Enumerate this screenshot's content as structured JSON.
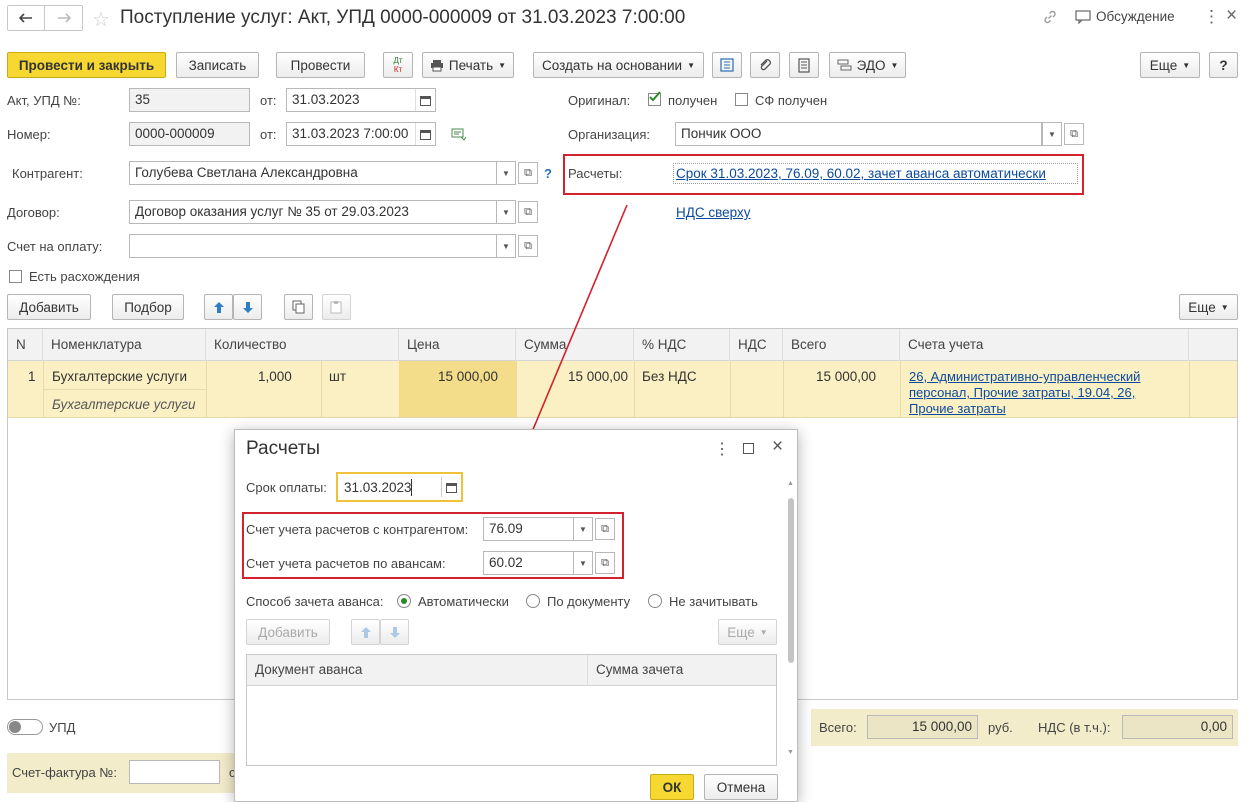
{
  "window": {
    "title": "Поступление услуг: Акт, УПД 0000-000009 от 31.03.2023 7:00:00",
    "discussion": "Обсуждение"
  },
  "toolbar": {
    "post_close": "Провести и закрыть",
    "save": "Записать",
    "post": "Провести",
    "dtkt_top": "Дт",
    "dtkt_bottom": "Кт",
    "print": "Печать",
    "create_based": "Создать на основании",
    "edo": "ЭДО",
    "more": "Еще",
    "help": "?"
  },
  "form": {
    "act_label": "Акт, УПД №:",
    "act_value": "35",
    "from_label": "от:",
    "act_date": "31.03.2023",
    "number_label": "Номер:",
    "number_value": "0000-000009",
    "number_date": "31.03.2023  7:00:00",
    "original_label": "Оригинал:",
    "received_label": "получен",
    "sf_received_label": "СФ получен",
    "org_label": "Организация:",
    "org_value": "Пончик ООО",
    "counterparty_label": "Контрагент:",
    "counterparty_value": "Голубева Светлана Александровна",
    "question": "?",
    "settlements_label": "Расчеты:",
    "settlements_link": "Срок 31.03.2023, 76.09, 60.02, зачет аванса автоматически",
    "vat_link": "НДС сверху",
    "contract_label": "Договор:",
    "contract_value": "Договор оказания услуг № 35 от 29.03.2023",
    "invoice_label": "Счет на оплату:",
    "invoice_value": "",
    "discrepancy_label": "Есть расхождения"
  },
  "table_toolbar": {
    "add": "Добавить",
    "select": "Подбор",
    "more": "Еще"
  },
  "table": {
    "headers": [
      "N",
      "Номенклатура",
      "Количество",
      "Цена",
      "Сумма",
      "% НДС",
      "НДС",
      "Всего",
      "Счета учета"
    ],
    "row": {
      "n": "1",
      "item": "Бухгалтерские услуги",
      "item_sub": "Бухгалтерские услуги",
      "qty": "1,000",
      "unit": "шт",
      "price": "15 000,00",
      "sum": "15 000,00",
      "vat_rate": "Без НДС",
      "vat": "",
      "total": "15 000,00",
      "accounts_1": "26, Административно-управленческий",
      "accounts_2": "персонал, Прочие затраты, 19.04, 26,",
      "accounts_3": "Прочие затраты"
    }
  },
  "footer": {
    "upd_label": "УПД",
    "total_label": "Всего:",
    "total_value": "15 000,00",
    "currency": "руб.",
    "vat_label": "НДС (в т.ч.):",
    "vat_value": "0,00",
    "invoice_label": "Счет-фактура №:",
    "invoice_value": "",
    "cut_text": "с"
  },
  "dialog": {
    "title": "Расчеты",
    "due_label": "Срок оплаты:",
    "due_value": "31.03.2023",
    "acc_cp_label": "Счет учета расчетов с контрагентом:",
    "acc_cp_value": "76.09",
    "acc_adv_label": "Счет учета расчетов по авансам:",
    "acc_adv_value": "60.02",
    "offset_label": "Способ зачета аванса:",
    "opt_auto": "Автоматически",
    "opt_doc": "По документу",
    "opt_none": "Не зачитывать",
    "add": "Добавить",
    "more": "Еще",
    "col_doc": "Документ аванса",
    "col_sum": "Сумма зачета",
    "ok": "ОК",
    "cancel": "Отмена"
  },
  "colors": {
    "accent": "#f7d731",
    "row_highlight": "#fbf0c4",
    "annotation": "#d3212d",
    "link": "#0b4a9c"
  }
}
